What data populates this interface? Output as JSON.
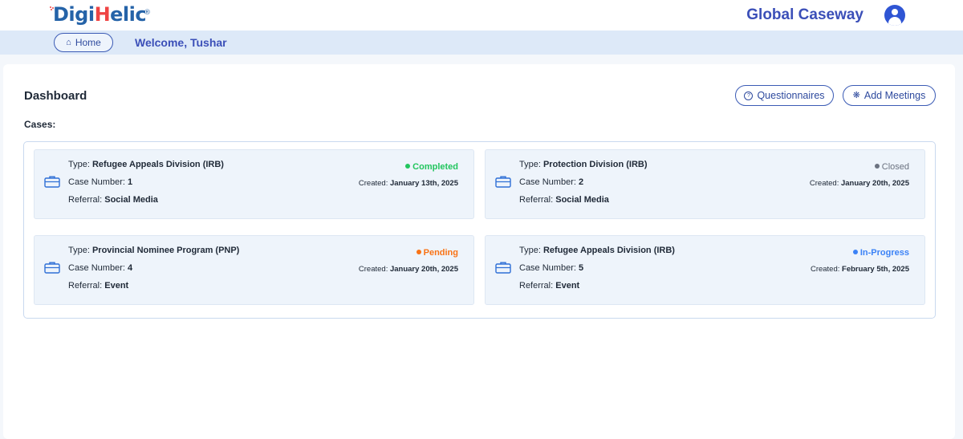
{
  "header": {
    "logo": {
      "part1": "Digi",
      "part2": "H",
      "part3": "elic",
      "reg": "®"
    },
    "brand": "Global Caseway",
    "avatar_icon": "user-circle-icon"
  },
  "nav": {
    "home_label": "Home",
    "home_icon": "home-icon",
    "welcome": "Welcome, Tushar"
  },
  "dashboard": {
    "title": "Dashboard",
    "cases_label": "Cases:",
    "questionnaires_label": "Questionnaires",
    "questionnaires_icon": "question-circle-icon",
    "add_meetings_label": "Add Meetings",
    "add_meetings_icon": "asterisk-icon"
  },
  "labels": {
    "type": "Type:",
    "case_number": "Case Number:",
    "referral": "Referral:",
    "created": "Created:"
  },
  "cases": [
    {
      "type": "Refugee Appeals Division (IRB)",
      "case_number": "1",
      "referral": "Social Media",
      "status": "Completed",
      "status_color": "#22c55e",
      "created": "January 13th, 2025"
    },
    {
      "type": "Protection Division (IRB)",
      "case_number": "2",
      "referral": "Social Media",
      "status": "Closed",
      "status_color": "#6b7280",
      "created": "January 20th, 2025"
    },
    {
      "type": "Provincial Nominee Program (PNP)",
      "case_number": "4",
      "referral": "Event",
      "status": "Pending",
      "status_color": "#f97316",
      "created": "January 20th, 2025"
    },
    {
      "type": "Refugee Appeals Division (IRB)",
      "case_number": "5",
      "referral": "Event",
      "status": "In-Progress",
      "status_color": "#3b82f6",
      "created": "February 5th, 2025"
    }
  ],
  "colors": {
    "accent": "#3b4fb8",
    "subbar": "#dde9f8",
    "card_bg": "#eef4fb",
    "icon": "#2e6fd6"
  }
}
